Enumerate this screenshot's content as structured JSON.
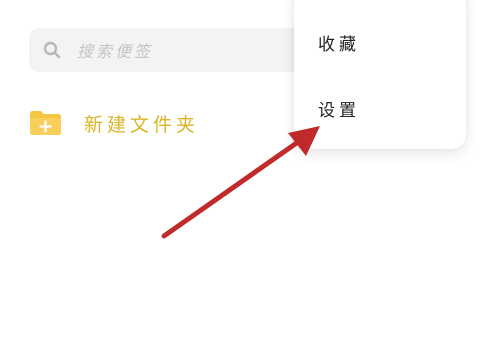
{
  "search": {
    "placeholder": "搜索便签",
    "icon": "search-icon"
  },
  "folder": {
    "new_label": "新建文件夹",
    "icon": "folder-plus-icon",
    "color": "#d9b62a",
    "icon_color": "#f5c544"
  },
  "menu": {
    "items": [
      {
        "label": "收藏"
      },
      {
        "label": "设置"
      }
    ]
  },
  "annotation": {
    "arrow_color": "#c12a2a",
    "points_to": "设置"
  }
}
